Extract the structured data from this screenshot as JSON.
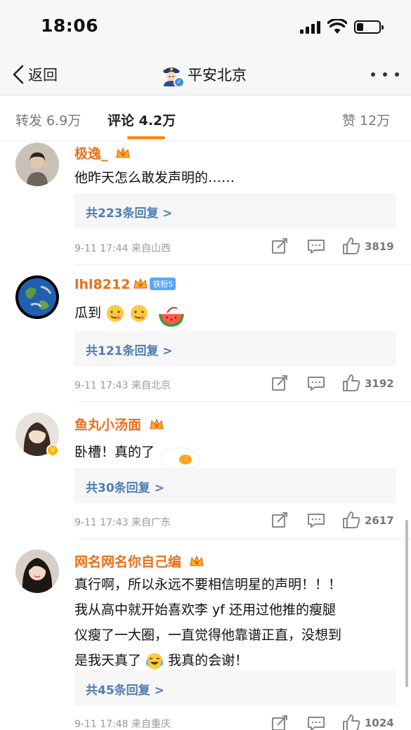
{
  "status_bar": {
    "time": "18:06",
    "battery_level": 0.3
  },
  "nav": {
    "back_label": "返回",
    "title": "平安北京"
  },
  "tabs": [
    {
      "label": "转发 6.9万"
    },
    {
      "label": "评论 4.2万",
      "active": true
    },
    {
      "label": "赞 12万"
    }
  ],
  "colors": {
    "accent": "#ff8200",
    "username": "#ea6f1a",
    "reply_link": "#4f7db3"
  },
  "comments": [
    {
      "username": "极逸_",
      "text": "他昨天怎么敢发声明的……",
      "reply_label": "共223条回复 >",
      "meta": "9-11 17:44  来自山西",
      "likes": "3819"
    },
    {
      "username": "lhl8212",
      "fan_badge": "铁粉5",
      "text": "瓜到",
      "reply_label": "共121条回复 >",
      "meta": "9-11 17:43  来自北京",
      "likes": "3192"
    },
    {
      "username": "鱼丸小汤面",
      "text": "卧槽！真的了",
      "reply_label": "共30条回复 >",
      "meta": "9-11 17:43  来自广东",
      "likes": "2617"
    },
    {
      "username": "网名网名你自己编",
      "text_lines": [
        "真行啊，所以永远不要相信明星的声明！！！",
        "我从高中就开始喜欢李 yf 还用过他推的瘦腿",
        "仪瘦了一大圈，一直觉得他靠谱正直，没想到",
        "是我天真了",
        "我真的会谢！"
      ],
      "reply_label": "共45条回复 >",
      "meta": "9-11 17:48  来自重庆",
      "likes": "1024"
    }
  ]
}
